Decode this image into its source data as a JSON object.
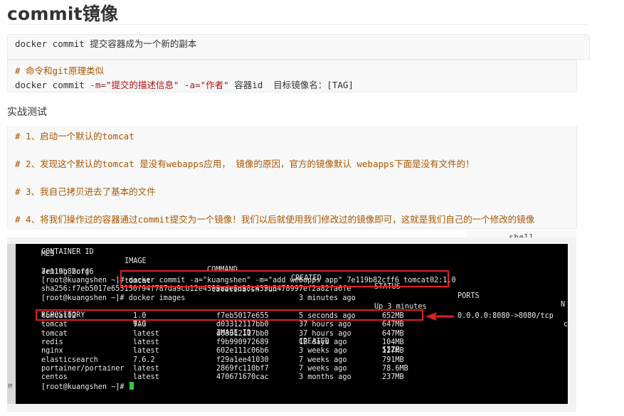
{
  "page": {
    "title": "commit镜像",
    "section_label": "实战测试"
  },
  "code_block_1": {
    "lines": [
      {
        "cmd": "docker commit",
        "desc": " 提交容器成为一个新的副本"
      },
      {
        "comment": "# 命令和git原理类似"
      },
      {
        "p1": "docker commit ",
        "opt1": "-m=",
        "str1": "\"提交的描述信息\"",
        "sp": " ",
        "opt2": "-a=",
        "str2": "\"作者\"",
        "rest": " 容器id  目标镜像名：[TAG]"
      }
    ]
  },
  "code_block_2": {
    "comments": [
      "# 1、启动一个默认的tomcat",
      "# 2、发现这个默认的tomcat 是没有webapps应用， 镜像的原因，官方的镜像默认 webapps下面是没有文件的！",
      "# 3、我自己拷贝进去了基本的文件",
      "# 4、将我们操作过的容器通过commit提交为一个镜像！我们以后就使用我们修改过的镜像即可，这就是我们自己的一个修改的镜像"
    ]
  },
  "shell_label": "shell",
  "side_label": "終",
  "terminal": {
    "ps_header": [
      "CONTAINER ID",
      "IMAGE",
      "COMMAND",
      "CREATED",
      "STATUS",
      "PORTS",
      "N"
    ],
    "mes": "MES",
    "ps_row": [
      "7e119b82cff6",
      "tomcat",
      "\"catalina.sh run\"",
      "3 minutes ago",
      "Up 3 minutes",
      "0.0.0.0:8080->8080/tcp",
      "c"
    ],
    "arming": "arming_borg",
    "prompt": "[root@kuangshen ~]#",
    "commit_cmd": "docker commit -a=\"kuangshen\" -m=\"add webapps app\" 7e119b82cff6 tomcat02:1.0",
    "sha": "sha256:f7eb5017e655150f94f787da9cb12e4399ade8d98c435b3478997ef2a82fa6fe",
    "images_cmd": "docker images",
    "images_header": [
      "REPOSITORY",
      "TAG",
      "IMAGE ID",
      "CREATED",
      "SIZE"
    ],
    "images": [
      [
        "tomcat02",
        "1.0",
        "f7eb5017e655",
        "5 seconds ago",
        "652MB"
      ],
      [
        "tomcat",
        "9.0",
        "d03312117bb0",
        "37 hours ago",
        "647MB"
      ],
      [
        "tomcat",
        "latest",
        "d03312117bb0",
        "37 hours ago",
        "647MB"
      ],
      [
        "redis",
        "latest",
        "f9b990972689",
        "12 days ago",
        "104MB"
      ],
      [
        "nginx",
        "latest",
        "602e111c06b6",
        "3 weeks ago",
        "127MB"
      ],
      [
        "elasticsearch",
        "7.6.2",
        "f29a1ee41030",
        "7 weeks ago",
        "791MB"
      ],
      [
        "portainer/portainer",
        "latest",
        "2869fc110bf7",
        "7 weeks ago",
        "78.6MB"
      ],
      [
        "centos",
        "latest",
        "470671670cac",
        "3 months ago",
        "237MB"
      ]
    ]
  },
  "colors": {
    "highlight": "#e02020",
    "cursor": "#2ecc40",
    "comment": "#aa5500"
  }
}
